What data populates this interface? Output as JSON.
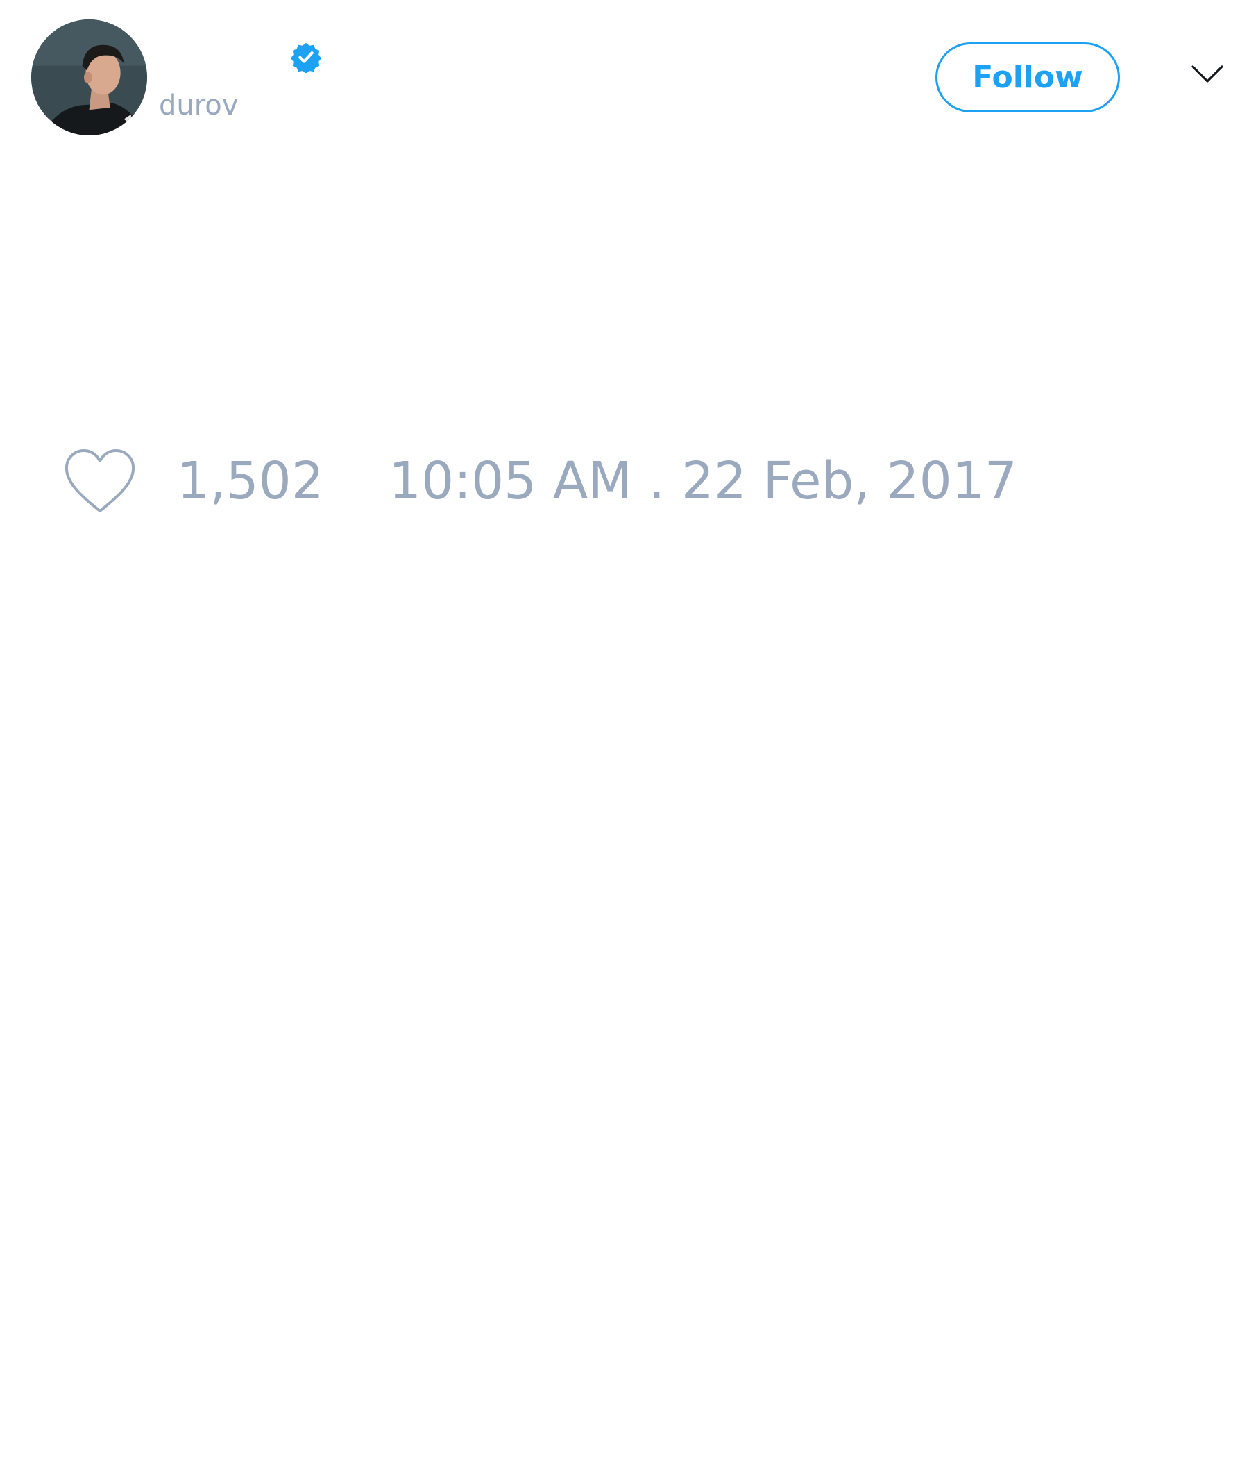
{
  "header": {
    "display_name": "",
    "handle": "durov",
    "verified": true,
    "follow_label": "Follow",
    "avatar_icon": "user-avatar-photo",
    "badge_icon": "verified-badge-icon",
    "menu_icon": "chevron-down-icon"
  },
  "stats": {
    "like_icon": "heart-icon",
    "like_count": "1,502",
    "timestamp": "10:05 AM . 22 Feb, 2017"
  },
  "colors": {
    "accent": "#1da1f2",
    "muted": "#9aa9bd",
    "background": "#ffffff"
  }
}
